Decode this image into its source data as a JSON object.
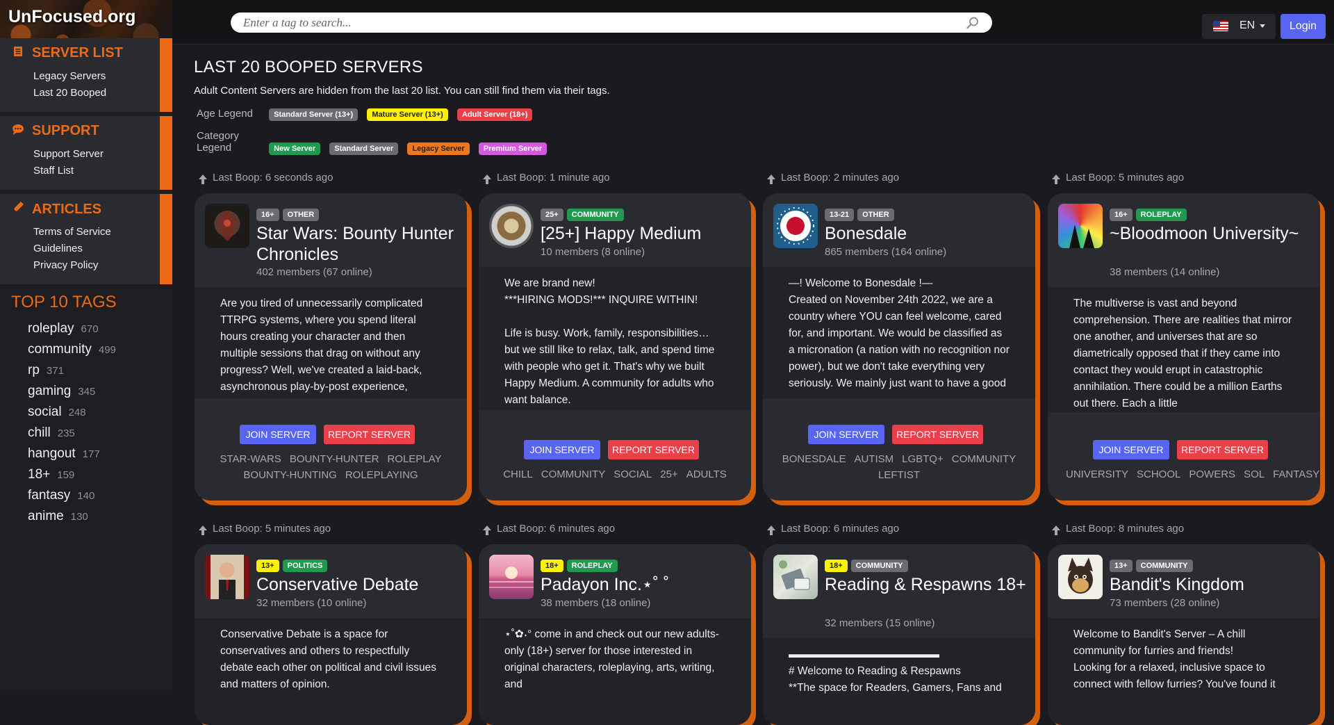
{
  "brand": "UnFocused.org",
  "search": {
    "placeholder": "Enter a tag to search..."
  },
  "lang": {
    "label": "EN"
  },
  "login_label": "Login",
  "sidebar": {
    "sections": [
      {
        "title": "SERVER LIST",
        "icon": "list-icon",
        "links": [
          "Legacy Servers",
          "Last 20 Booped"
        ]
      },
      {
        "title": "SUPPORT",
        "icon": "chat-icon",
        "links": [
          "Support Server",
          "Staff List"
        ]
      },
      {
        "title": "ARTICLES",
        "icon": "pen-icon",
        "links": [
          "Terms of Service",
          "Guidelines",
          "Privacy Policy"
        ]
      }
    ],
    "top_tags_title": "TOP 10 TAGS",
    "top_tags": [
      {
        "name": "roleplay",
        "count": "670"
      },
      {
        "name": "community",
        "count": "499"
      },
      {
        "name": "rp",
        "count": "371"
      },
      {
        "name": "gaming",
        "count": "345"
      },
      {
        "name": "social",
        "count": "248"
      },
      {
        "name": "chill",
        "count": "235"
      },
      {
        "name": "hangout",
        "count": "177"
      },
      {
        "name": "18+",
        "count": "159"
      },
      {
        "name": "fantasy",
        "count": "140"
      },
      {
        "name": "anime",
        "count": "130"
      }
    ]
  },
  "main": {
    "title": "LAST 20 BOOPED SERVERS",
    "notice": "Adult Content Servers are hidden from the last 20 list. You can still find them via their tags.",
    "age_legend": {
      "label": "Age Legend",
      "items": [
        "Standard Server (13+)",
        "Mature Server (13+)",
        "Adult Server (18+)"
      ]
    },
    "category_legend": {
      "label": "Category Legend",
      "items": [
        "New Server",
        "Standard Server",
        "Legacy Server",
        "Premium Server"
      ]
    }
  },
  "buttons": {
    "join": "JOIN SERVER",
    "report": "REPORT SERVER"
  },
  "cards": [
    {
      "boop": "Last Boop: 6 seconds ago",
      "age": "16+",
      "category": "OTHER",
      "name": "Star Wars: Bounty Hunter Chronicles",
      "members": "402 members (67 online)",
      "desc": "Are you tired of unnecessarily complicated TTRPG systems, where you spend literal hours creating your character and then multiple sessions that drag on without any progress? Well, we've created a laid-back, asynchronous play-by-post experience,",
      "tags": [
        "STAR-WARS",
        "BOUNTY-HUNTER",
        "ROLEPLAY",
        "BOUNTY-HUNTING",
        "ROLEPLAYING"
      ]
    },
    {
      "boop": "Last Boop: 1 minute ago",
      "age": "25+",
      "category": "COMMUNITY",
      "name": "[25+] Happy Medium",
      "members": "10 members (8 online)",
      "desc": "We are brand new!\n***HIRING MODS!*** INQUIRE WITHIN!\n\nLife is busy. Work, family, responsibilities… but we still like to relax, talk, and spend time with people who get it. That's why we built Happy Medium. A community for adults who want balance.",
      "tags": [
        "CHILL",
        "COMMUNITY",
        "SOCIAL",
        "25+",
        "ADULTS"
      ]
    },
    {
      "boop": "Last Boop: 2 minutes ago",
      "age": "13-21",
      "category": "OTHER",
      "name": "Bonesdale",
      "members": "865 members (164 online)",
      "desc": "—! Welcome to Bonesdale !—\nCreated on November 24th 2022, we are a country where YOU can feel welcome, cared for, and important. We would be classified as a micronation (a nation with no recognition nor power), but we don't take everything very seriously. We mainly just want to have a good time with a good",
      "tags": [
        "BONESDALE",
        "AUTISM",
        "LGBTQ+",
        "COMMUNITY",
        "LEFTIST"
      ]
    },
    {
      "boop": "Last Boop: 5 minutes ago",
      "age": "16+",
      "category": "ROLEPLAY",
      "name": "~Bloodmoon University~",
      "members": "38 members (14 online)",
      "desc": "The multiverse is vast and beyond comprehension. There are realities that mirror one another, and universes that are so diametrically opposed that if they came into contact they would erupt in catastrophic annihilation. There could be a million Earths out there. Each a little",
      "tags": [
        "UNIVERSITY",
        "SCHOOL",
        "POWERS",
        "SOL",
        "FANTASY"
      ]
    },
    {
      "boop": "Last Boop: 5 minutes ago",
      "age": "13+",
      "category": "POLITICS",
      "name": "Conservative Debate",
      "members": "32 members (10 online)",
      "desc": "Conservative Debate is a space for conservatives and others to respectfully debate each other on political and civil issues and matters of opinion.",
      "tags": []
    },
    {
      "boop": "Last Boop: 6 minutes ago",
      "age": "18+",
      "category": "ROLEPLAY",
      "name": "Padayon Inc.⋆˚ ˚",
      "members": "38 members (18 online)",
      "desc": "⋆˚✿˖° come in and check out our new adults-only (18+) server for those interested in original characters, roleplaying, arts, writing, and",
      "tags": []
    },
    {
      "boop": "Last Boop: 6 minutes ago",
      "age": "18+",
      "category": "COMMUNITY",
      "name": "Reading & Respawns 18+",
      "members": "32 members (15 online)",
      "desc": "▬▬▬▬▬▬▬▬▬▬▬▬▬▬\n# Welcome to Reading & Respawns\n**The space for Readers, Gamers, Fans and",
      "tags": []
    },
    {
      "boop": "Last Boop: 8 minutes ago",
      "age": "13+",
      "category": "COMMUNITY",
      "name": "Bandit's Kingdom",
      "members": "73 members (28 online)",
      "desc": "Welcome to Bandit's Server – A chill community for furries and friends!\nLooking for a relaxed, inclusive space to connect with fellow furries? You've found it",
      "tags": []
    }
  ]
}
